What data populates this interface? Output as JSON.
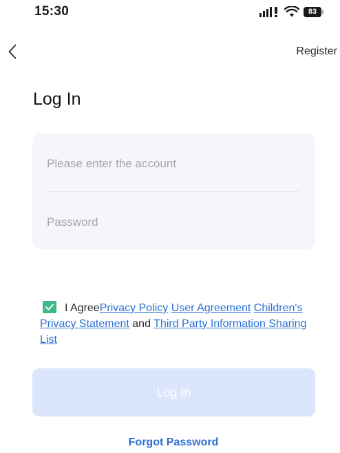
{
  "status_bar": {
    "time": "15:30",
    "battery_level": "83",
    "icons": [
      "signal-icon",
      "wifi-icon",
      "battery-icon"
    ]
  },
  "nav": {
    "back_icon": "chevron-left-icon",
    "register_label": "Register"
  },
  "page": {
    "title": "Log In"
  },
  "form": {
    "account_placeholder": "Please enter the account",
    "account_value": "",
    "password_placeholder": "Password",
    "password_value": ""
  },
  "agreement": {
    "checked": true,
    "checkbox_color": "#3fb88a",
    "prefix": "I Agree",
    "privacy_policy": "Privacy Policy",
    "user_agreement": "User Agreement",
    "children_privacy": "Children's Privacy Statement",
    "and_text": "and",
    "third_party": "Third Party Information Sharing List"
  },
  "actions": {
    "login_label": "Log In",
    "login_enabled": false,
    "login_color": "#dbe6fc",
    "forgot_password_label": "Forgot Password",
    "link_color": "#2a6fd6"
  }
}
